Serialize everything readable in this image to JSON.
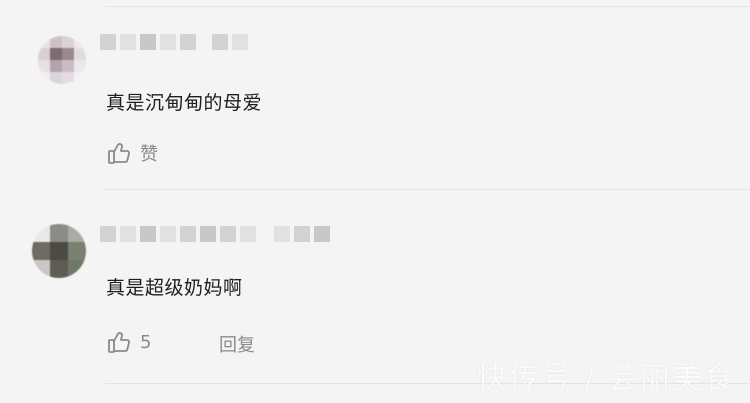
{
  "comments": [
    {
      "text": "真是沉甸甸的母爱",
      "like_label": "赞"
    },
    {
      "text": "真是超级奶妈啊",
      "like_count": "5",
      "reply_label": "回复"
    }
  ],
  "watermark": "快传号 / 芸丽美食",
  "icons": {
    "like": "thumbs-up-icon"
  }
}
